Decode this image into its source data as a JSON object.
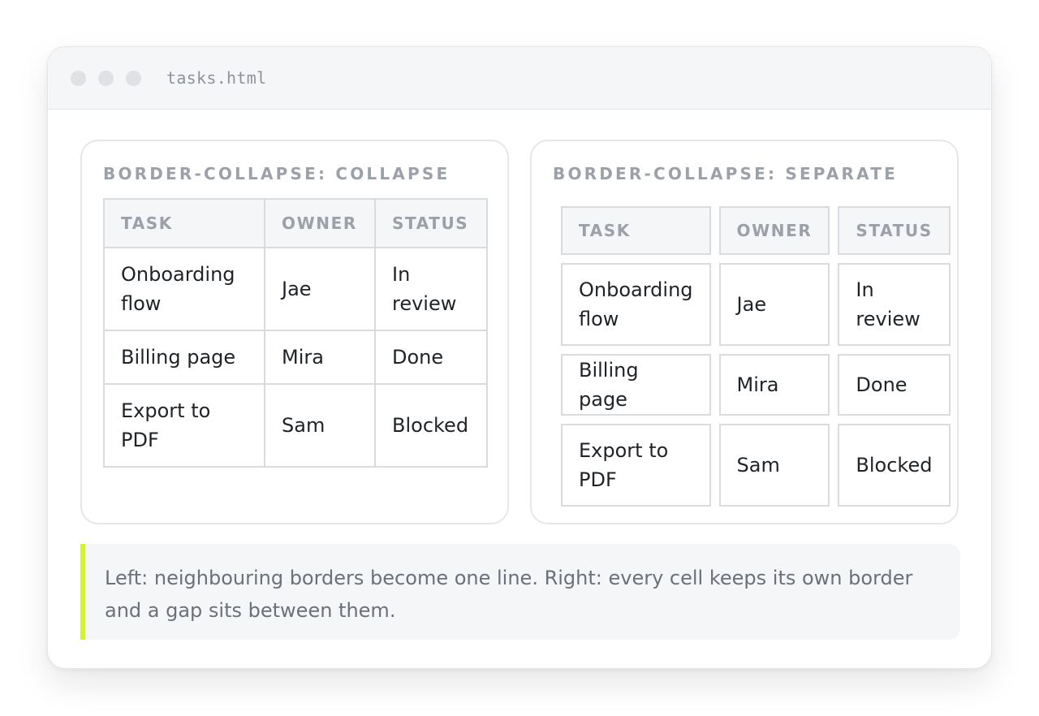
{
  "window": {
    "filename": "tasks.html"
  },
  "collapse_panel": {
    "title": "border-collapse: collapse",
    "headers": [
      "Task",
      "Owner",
      "Status"
    ],
    "rows": [
      [
        "Onboarding flow",
        "Jae",
        "In review"
      ],
      [
        "Billing page",
        "Mira",
        "Done"
      ],
      [
        "Export to PDF",
        "Sam",
        "Blocked"
      ]
    ]
  },
  "separate_panel": {
    "title": "border-collapse: separate",
    "headers": [
      "Task",
      "Owner",
      "Status"
    ],
    "rows": [
      [
        "Onboarding flow",
        "Jae",
        "In review"
      ],
      [
        "Billing page",
        "Mira",
        "Done"
      ],
      [
        "Export to PDF",
        "Sam",
        "Blocked"
      ]
    ]
  },
  "note": {
    "text": "Left: neighbouring borders become one line. Right: every cell keeps its own border and a gap sits between them."
  },
  "colors": {
    "accent": "#d4f32f",
    "border": "#d9dbdf",
    "header_bg": "#f5f6f8"
  }
}
